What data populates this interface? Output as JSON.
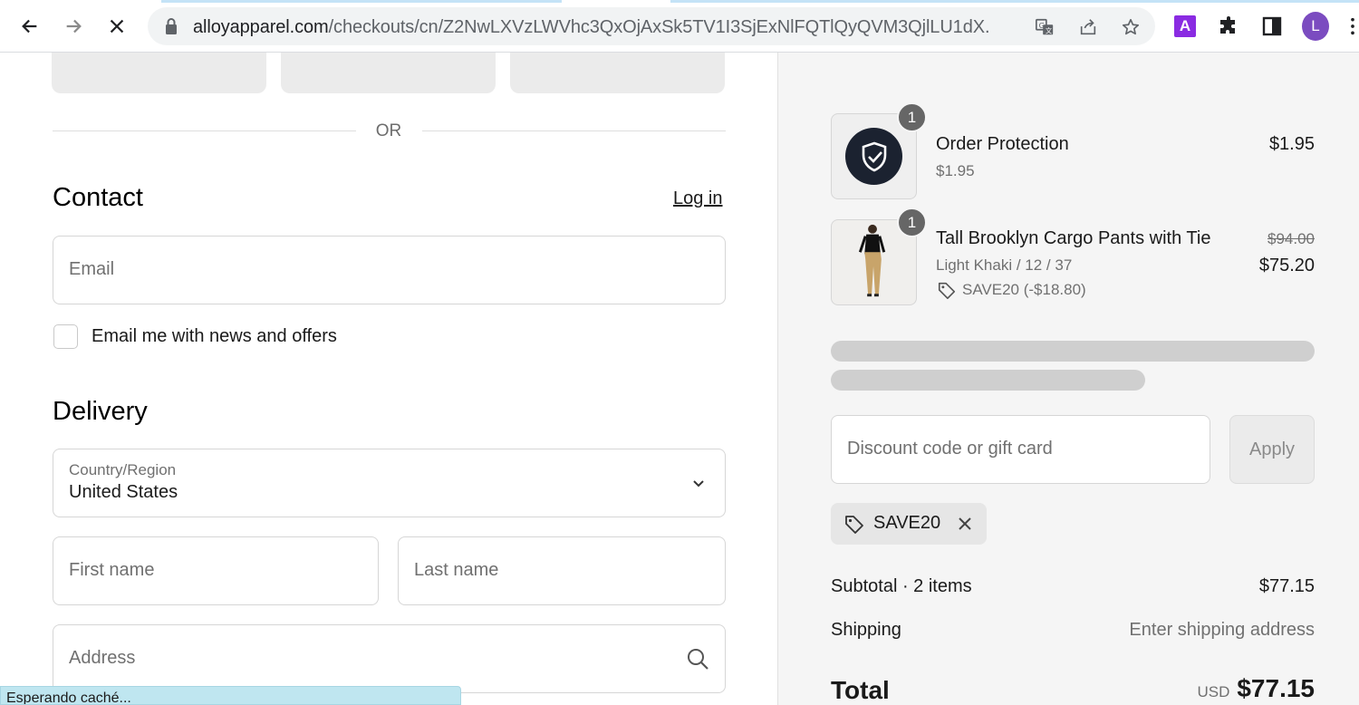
{
  "browser": {
    "url_host": "alloyapparel.com",
    "url_path": "/checkouts/cn/Z2NwLXVzLWVhc3QxOjAxSk5TV1I3SjExNlFQTlQyQVM3QjlLU1dX...",
    "extension_a_label": "A",
    "profile_initial": "L",
    "status_text": "Esperando caché..."
  },
  "checkout": {
    "or_label": "OR",
    "contact_heading": "Contact",
    "login_link": "Log in",
    "email_placeholder": "Email",
    "newsletter_label": "Email me with news and offers",
    "delivery_heading": "Delivery",
    "country_label": "Country/Region",
    "country_value": "United States",
    "first_name_placeholder": "First name",
    "last_name_placeholder": "Last name",
    "address_placeholder": "Address"
  },
  "summary": {
    "items": [
      {
        "quantity": "1",
        "title": "Order Protection",
        "subtitle": "$1.95",
        "price": "$1.95"
      },
      {
        "quantity": "1",
        "title": "Tall Brooklyn Cargo Pants with Tie",
        "variant": "Light Khaki / 12 / 37",
        "discount": "SAVE20 (-$18.80)",
        "original_price": "$94.00",
        "price": "$75.20"
      }
    ],
    "discount_placeholder": "Discount code or gift card",
    "apply_label": "Apply",
    "applied_code": "SAVE20",
    "subtotal_label": "Subtotal · 2 items",
    "subtotal_value": "$77.15",
    "shipping_label": "Shipping",
    "shipping_value": "Enter shipping address",
    "total_label": "Total",
    "total_currency": "USD",
    "total_value": "$77.15"
  },
  "icons": {
    "back": "arrow-left-icon",
    "forward": "arrow-right-icon",
    "stop": "close-icon",
    "lock": "lock-icon",
    "translate": "translate-icon",
    "share": "share-icon",
    "bookmark": "star-icon",
    "extensions": "puzzle-icon",
    "side_panel": "side-panel-icon",
    "menu": "more-vertical-icon",
    "shield": "shield-check-icon",
    "tag": "tag-icon",
    "search": "search-icon",
    "chevron": "chevron-down-icon"
  },
  "colors": {
    "summary_bg": "#f5f5f5",
    "shield_bg": "#1b2230",
    "badge_bg": "#666666",
    "profile_bg": "#7b4cc0",
    "extension_a_bg": "#8a2be2"
  }
}
